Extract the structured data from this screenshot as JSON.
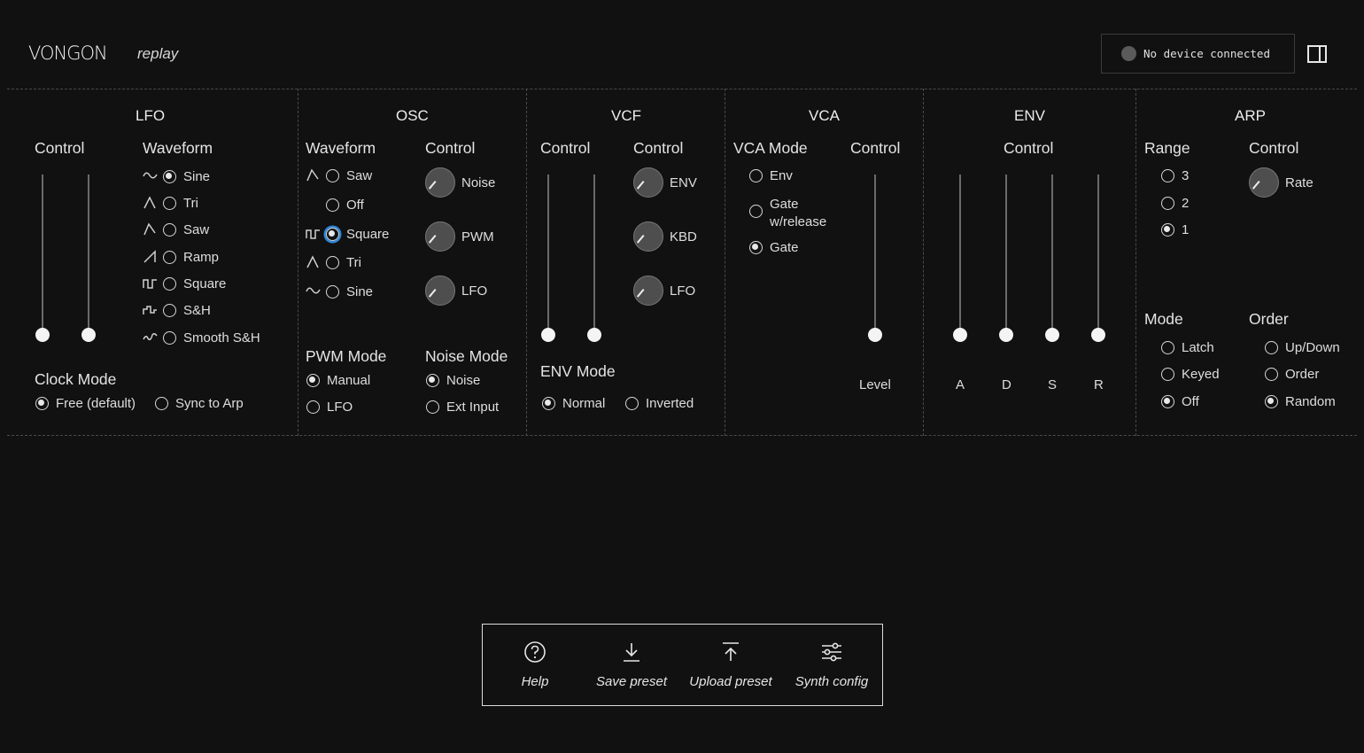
{
  "header": {
    "logo": "VONGON",
    "app_name": "replay",
    "device_status": "No device connected"
  },
  "lfo": {
    "title": "LFO",
    "control_label": "Control",
    "waveform_label": "Waveform",
    "waveforms": [
      "Sine",
      "Tri",
      "Saw",
      "Ramp",
      "Square",
      "S&H",
      "Smooth S&H"
    ],
    "clock_mode_label": "Clock Mode",
    "clock_modes": [
      "Free (default)",
      "Sync to Arp"
    ]
  },
  "osc": {
    "title": "OSC",
    "waveform_label": "Waveform",
    "waveforms": [
      "Saw",
      "Off",
      "Square",
      "Tri",
      "Sine"
    ],
    "control_label": "Control",
    "knobs": [
      "Noise",
      "PWM",
      "LFO"
    ],
    "pwm_mode_label": "PWM Mode",
    "pwm_modes": [
      "Manual",
      "LFO"
    ],
    "noise_mode_label": "Noise Mode",
    "noise_modes": [
      "Noise",
      "Ext Input"
    ]
  },
  "vcf": {
    "title": "VCF",
    "control_label_1": "Control",
    "control_label_2": "Control",
    "knobs": [
      "ENV",
      "KBD",
      "LFO"
    ],
    "env_mode_label": "ENV Mode",
    "env_modes": [
      "Normal",
      "Inverted"
    ]
  },
  "vca": {
    "title": "VCA",
    "mode_label": "VCA Mode",
    "modes": [
      "Env",
      "Gate\nw/release",
      "Gate"
    ],
    "control_label": "Control",
    "slider_label": "Level"
  },
  "env": {
    "title": "ENV",
    "control_label": "Control",
    "sliders": [
      "A",
      "D",
      "S",
      "R"
    ]
  },
  "arp": {
    "title": "ARP",
    "range_label": "Range",
    "ranges": [
      "3",
      "2",
      "1"
    ],
    "control_label": "Control",
    "knob": "Rate",
    "mode_label": "Mode",
    "modes": [
      "Latch",
      "Keyed",
      "Off"
    ],
    "order_label": "Order",
    "orders": [
      "Up/Down",
      "Order",
      "Random"
    ]
  },
  "toolbar": {
    "help": "Help",
    "save": "Save preset",
    "upload": "Upload preset",
    "config": "Synth config"
  },
  "selected": {
    "lfo_waveform": "Sine",
    "lfo_clock_mode": "Free (default)",
    "osc_waveform": "Square",
    "pwm_mode": "Manual",
    "noise_mode": "Noise",
    "env_mode": "Normal",
    "vca_mode": "Gate",
    "arp_range": "1",
    "arp_mode": "Off",
    "arp_order": "Random"
  },
  "colors": {
    "background": "#111112",
    "focus_ring": "#2f86d8"
  }
}
